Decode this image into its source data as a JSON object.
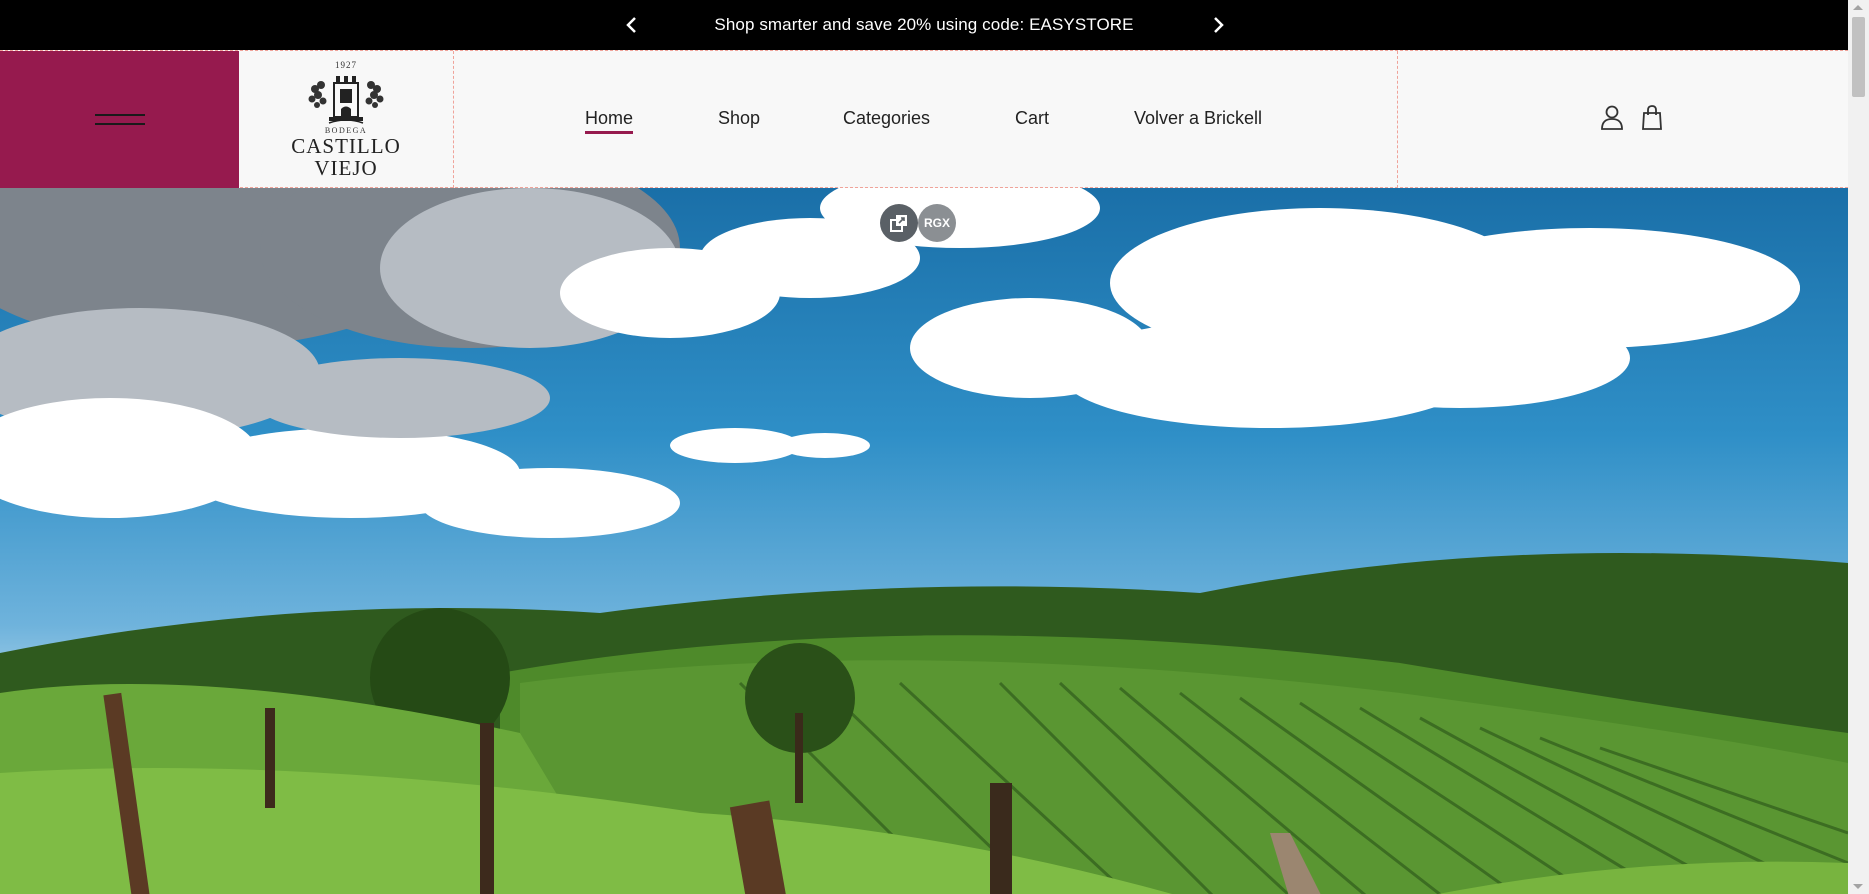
{
  "announcement": {
    "text": "Shop smarter and save 20% using code: EASYSTORE",
    "prev_icon": "chevron-left-icon",
    "next_icon": "chevron-right-icon"
  },
  "header": {
    "menu_icon": "hamburger-icon",
    "logo": {
      "year": "1927",
      "bodega": "BODEGA",
      "line1": "CASTILLO",
      "line2": "VIEJO"
    },
    "nav": [
      {
        "label": "Home",
        "active": true
      },
      {
        "label": "Shop"
      },
      {
        "label": "Categories"
      },
      {
        "label": "Cart"
      },
      {
        "label": "Volver a Brickell"
      }
    ],
    "account_icon": "user-icon",
    "cart_icon": "shopping-bag-icon"
  },
  "hero": {
    "overlay_buttons": [
      {
        "icon": "copy-icon",
        "label": ""
      },
      {
        "icon": "rgx-icon",
        "label": "RGX"
      }
    ]
  },
  "colors": {
    "brand": "#961a4e",
    "announcement_bg": "#000000",
    "header_bg": "#f8f8f8"
  }
}
